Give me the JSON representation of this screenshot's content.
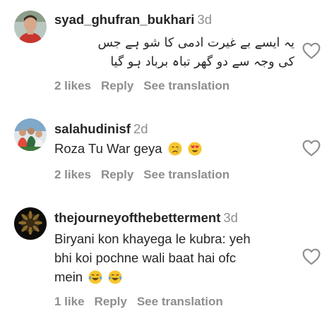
{
  "comments": [
    {
      "username": "syad_ghufran_bukhari",
      "time": "3d",
      "text_line1": "یہ ایسے بے غیرت ادمی کا شو ہے جس",
      "text_line2": "کی وجہ سے دو گھر تباہ برباد ہو گیا",
      "likes": "2 likes",
      "reply": "Reply",
      "translate": "See translation"
    },
    {
      "username": "salahudinisf",
      "time": "2d",
      "text_line1": "Roza Tu War geya",
      "emojis": [
        "crying-face",
        "heart-eyes-face"
      ],
      "likes": "2 likes",
      "reply": "Reply",
      "translate": "See translation"
    },
    {
      "username": "thejourneyofthebetterment",
      "time": "3d",
      "text_line1": "Biryani kon khayega le kubra: yeh",
      "text_line2": "bhi koi pochne wali baat hai ofc",
      "text_line3": "mein",
      "emojis": [
        "tears-of-joy-face",
        "tears-of-joy-face"
      ],
      "likes": "1 like",
      "reply": "Reply",
      "translate": "See translation"
    }
  ],
  "colors": {
    "text": "#262626",
    "secondary": "#8e8e8e",
    "heart_outline": "#8e8e8e",
    "emoji_yellow": "#f7c52e"
  }
}
